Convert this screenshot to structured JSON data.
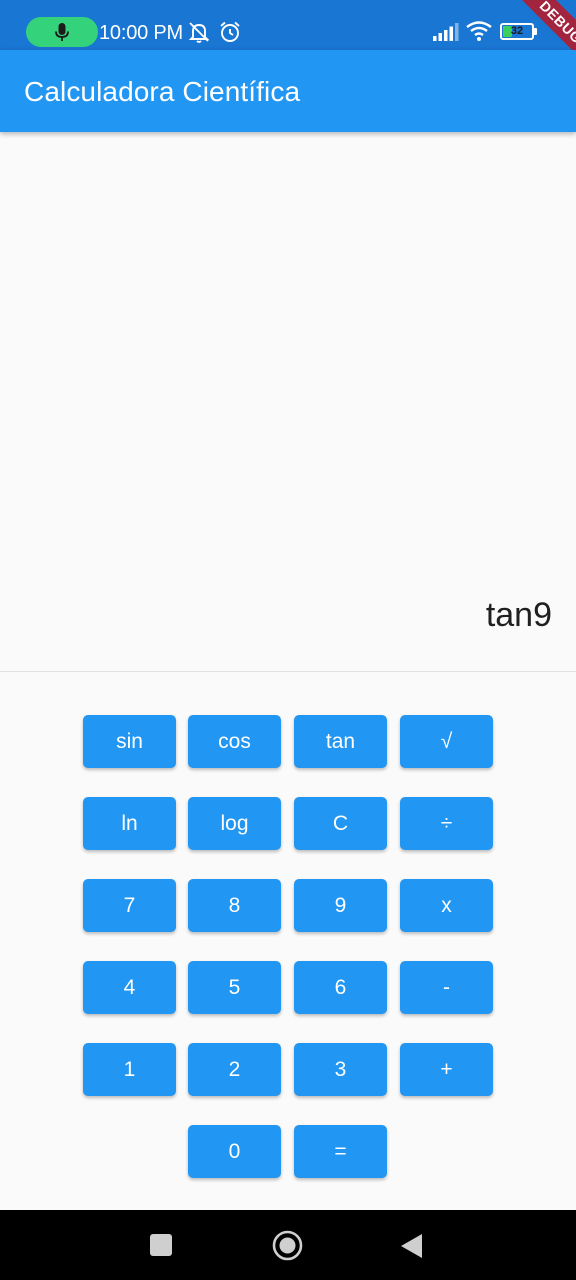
{
  "status_bar": {
    "time": "10:00 PM",
    "battery_level": "32",
    "battery_fraction": 0.32,
    "icons": [
      "mic-icon",
      "notifications-muted-icon",
      "alarm-icon",
      "signal-icon",
      "wifi-icon",
      "battery-icon"
    ],
    "debug_label": "DEBUG",
    "bar_color": "#1976d2"
  },
  "app_bar": {
    "title": "Calculadora Científica",
    "color": "#2196f3"
  },
  "display": {
    "expression": "tan9"
  },
  "keypad": {
    "button_color": "#2196f3",
    "rows": [
      [
        "sin",
        "cos",
        "tan",
        "√"
      ],
      [
        "ln",
        "log",
        "C",
        "÷"
      ],
      [
        "7",
        "8",
        "9",
        "x"
      ],
      [
        "4",
        "5",
        "6",
        "-"
      ],
      [
        "1",
        "2",
        "3",
        "+"
      ],
      [
        "0",
        "="
      ]
    ]
  },
  "nav_bar": {
    "buttons": [
      "recents-button",
      "home-button",
      "back-button"
    ]
  }
}
